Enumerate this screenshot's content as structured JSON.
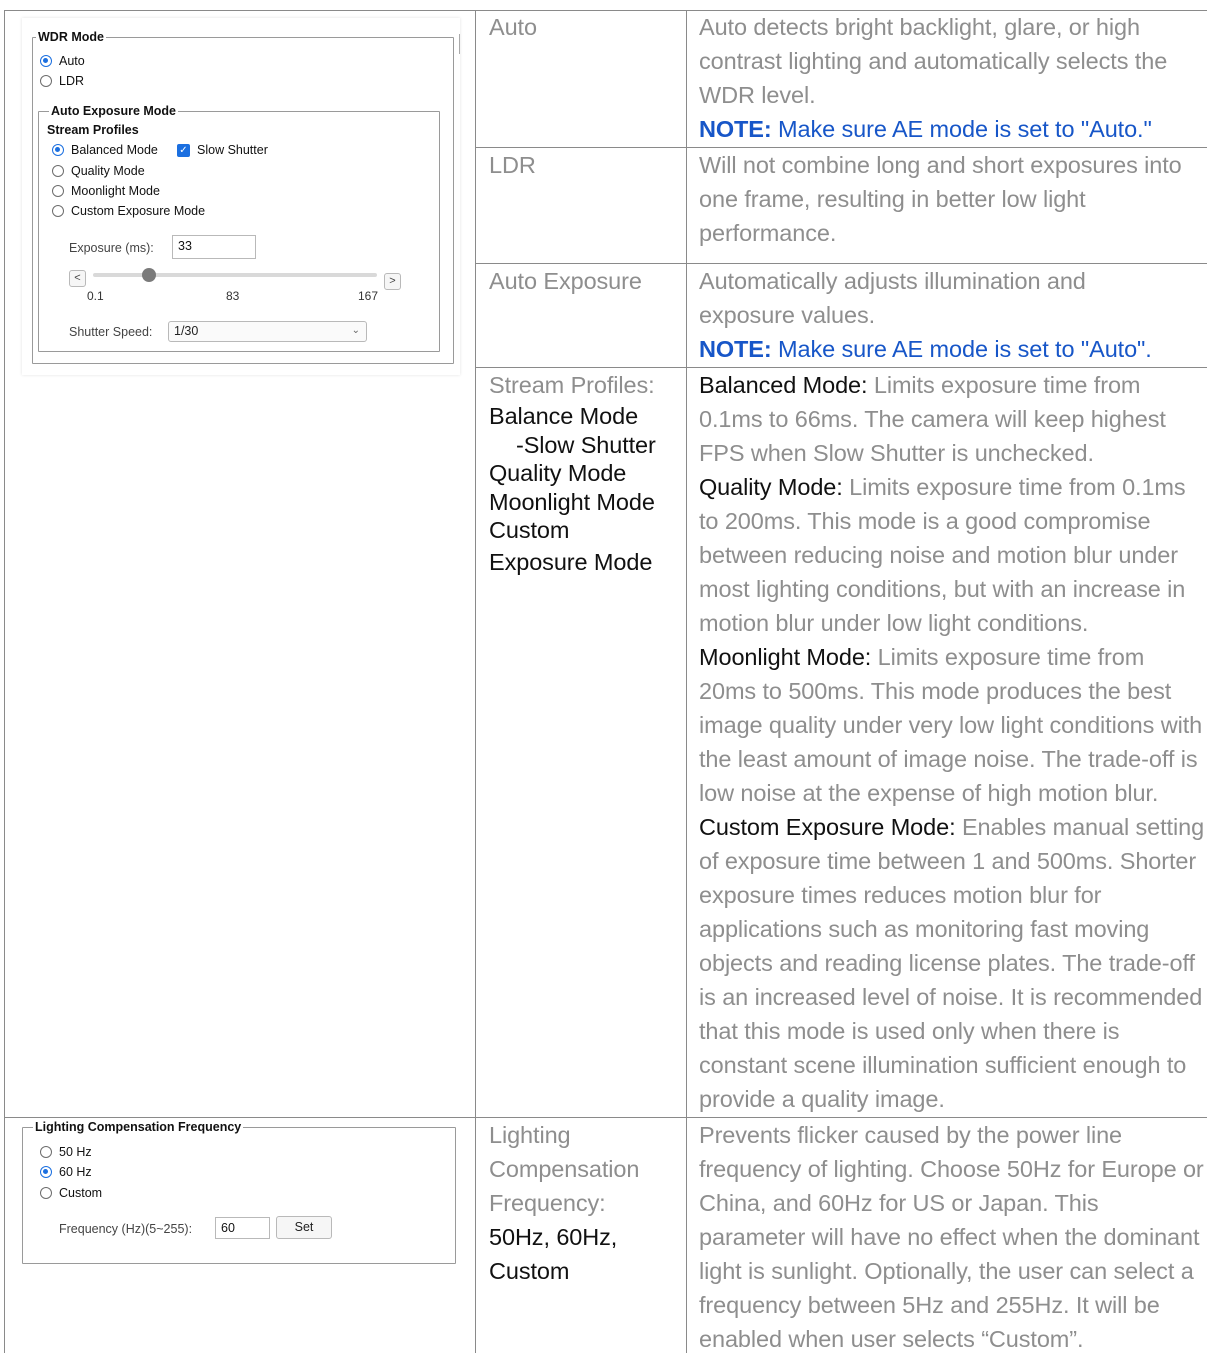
{
  "wdr_panel": {
    "wdr_legend": "WDR Mode",
    "wdr_options": [
      "Auto",
      "LDR"
    ],
    "wdr_selected": "Auto",
    "ae_legend": "Auto Exposure Mode",
    "stream_profiles_label": "Stream Profiles",
    "profiles": [
      "Balanced Mode",
      "Quality Mode",
      "Moonlight Mode",
      "Custom Exposure Mode"
    ],
    "profile_selected": "Balanced Mode",
    "slow_shutter_label": "Slow Shutter",
    "slow_shutter_checked": true,
    "exposure_label": "Exposure (ms):",
    "exposure_value": "33",
    "slider_min_label": "0.1",
    "slider_mid_label": "83",
    "slider_max_label": "167",
    "slider_value": 33,
    "slider_min": 0.1,
    "slider_max": 167,
    "prev_label": "<",
    "next_label": ">",
    "shutter_label": "Shutter Speed:",
    "shutter_value": "1/30"
  },
  "lcf_panel": {
    "legend": "Lighting Compensation Frequency",
    "options": [
      "50 Hz",
      "60 Hz",
      "Custom"
    ],
    "selected": "60 Hz",
    "frequency_label": "Frequency (Hz)(5~255):",
    "frequency_value": "60",
    "set_label": "Set"
  },
  "rows": [
    {
      "term": "Auto",
      "desc_lines": [
        "Auto detects bright backlight, glare, or high",
        "contrast lighting and automatically selects the",
        "WDR level."
      ],
      "note_label": "NOTE:",
      "note_text": " Make sure AE mode is set to \"Auto.\""
    },
    {
      "term": "LDR",
      "desc_lines": [
        "Will not combine long and short exposures into",
        "one frame, resulting in better low light",
        "performance."
      ]
    },
    {
      "term": "Auto Exposure",
      "desc_lines": [
        "Automatically adjusts illumination and",
        "exposure values."
      ],
      "note_label": "NOTE:",
      "note_text": " Make sure AE mode is set to \"Auto\"."
    },
    {
      "term_title": "Stream Profiles:",
      "term_items": [
        "Balance Mode",
        "-Slow Shutter",
        "Quality Mode",
        "Moonlight Mode",
        "Custom",
        "Exposure Mode"
      ],
      "modes": [
        {
          "name": "Balanced Mode:",
          "lines": [
            " Limits exposure time from",
            "0.1ms to 66ms. The camera will keep highest",
            "FPS when Slow Shutter is unchecked."
          ]
        },
        {
          "name": "Quality Mode:",
          "lines": [
            " Limits exposure time from 0.1ms",
            "to 200ms.  This mode is a good compromise",
            "between reducing noise and motion blur under",
            "most lighting conditions, but with an increase in",
            "motion blur under low light conditions."
          ]
        },
        {
          "name": "Moonlight Mode:",
          "lines": [
            " Limits exposure time from",
            "20ms to 500ms. This mode produces the best",
            "image quality under very low light conditions with",
            "the least amount of image noise. The trade-off is",
            "low noise at the expense of high motion blur."
          ]
        },
        {
          "name": "Custom Exposure Mode:",
          "lines": [
            " Enables manual setting",
            "of exposure time between 1 and 500ms. Shorter",
            "exposure times reduces motion blur for",
            "applications such as monitoring fast moving",
            "objects and reading license plates. The trade-off",
            "is an increased level of noise. It is recommended",
            "that this mode is used only when there is",
            "constant scene illumination sufficient enough to",
            "provide a quality image."
          ]
        }
      ]
    },
    {
      "term_lines": [
        "Lighting",
        "Compensation",
        "Frequency:"
      ],
      "term_values": [
        "50Hz, 60Hz,",
        "Custom"
      ],
      "desc_lines": [
        "Prevents flicker caused by the power line",
        "frequency of lighting. Choose 50Hz for Europe or",
        "China, and 60Hz for US or Japan. This",
        "parameter will have no effect when the dominant",
        "light is sunlight. Optionally, the user can select a",
        "frequency between 5Hz and 255Hz. It will be",
        "enabled when user selects “Custom”."
      ]
    }
  ]
}
